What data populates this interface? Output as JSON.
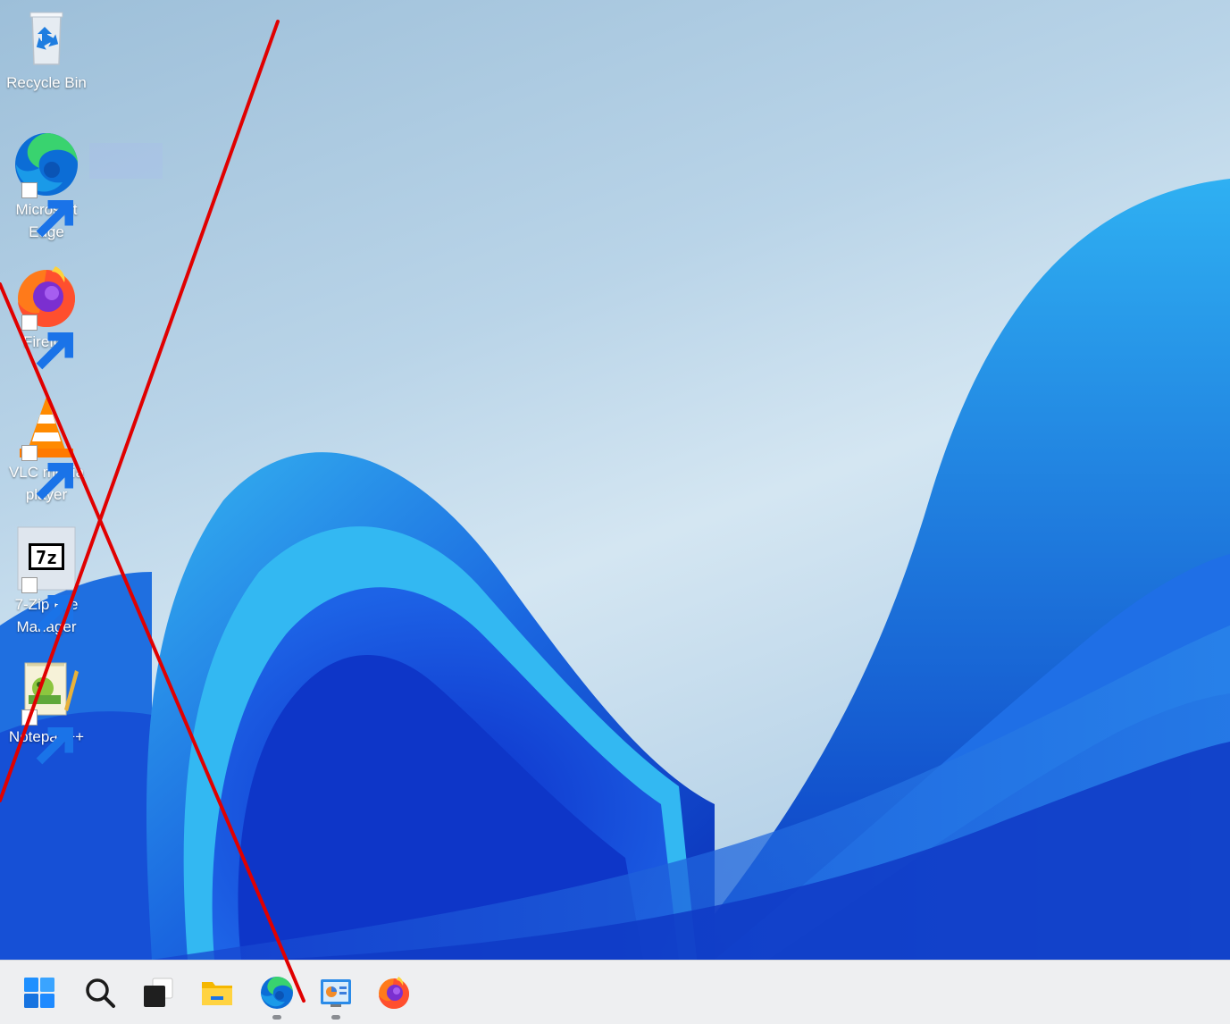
{
  "desktop": {
    "icons": [
      {
        "label": "Recycle Bin",
        "icon": "recycle-bin-icon",
        "shortcut": false
      },
      {
        "label": "Microsoft Edge",
        "icon": "edge-icon",
        "shortcut": true
      },
      {
        "label": "Firefox",
        "icon": "firefox-icon",
        "shortcut": true
      },
      {
        "label": "VLC media player",
        "icon": "vlc-icon",
        "shortcut": true
      },
      {
        "label": "7-Zip File Manager",
        "icon": "7zip-icon",
        "shortcut": true
      },
      {
        "label": "Notepad++",
        "icon": "notepad-plus-plus-icon",
        "shortcut": true
      }
    ],
    "sevenzip_glyph": "7z"
  },
  "taskbar": {
    "items": [
      {
        "icon": "start-icon",
        "running": false
      },
      {
        "icon": "search-icon",
        "running": false
      },
      {
        "icon": "task-view-icon",
        "running": false
      },
      {
        "icon": "file-explorer-icon",
        "running": false
      },
      {
        "icon": "edge-icon",
        "running": true
      },
      {
        "icon": "control-panel-icon",
        "running": true
      },
      {
        "icon": "firefox-icon",
        "running": false
      }
    ]
  },
  "colors": {
    "annotation_red": "#e00000",
    "taskbar_bg": "#eeeff1",
    "start_blue": "#1e90ff"
  }
}
